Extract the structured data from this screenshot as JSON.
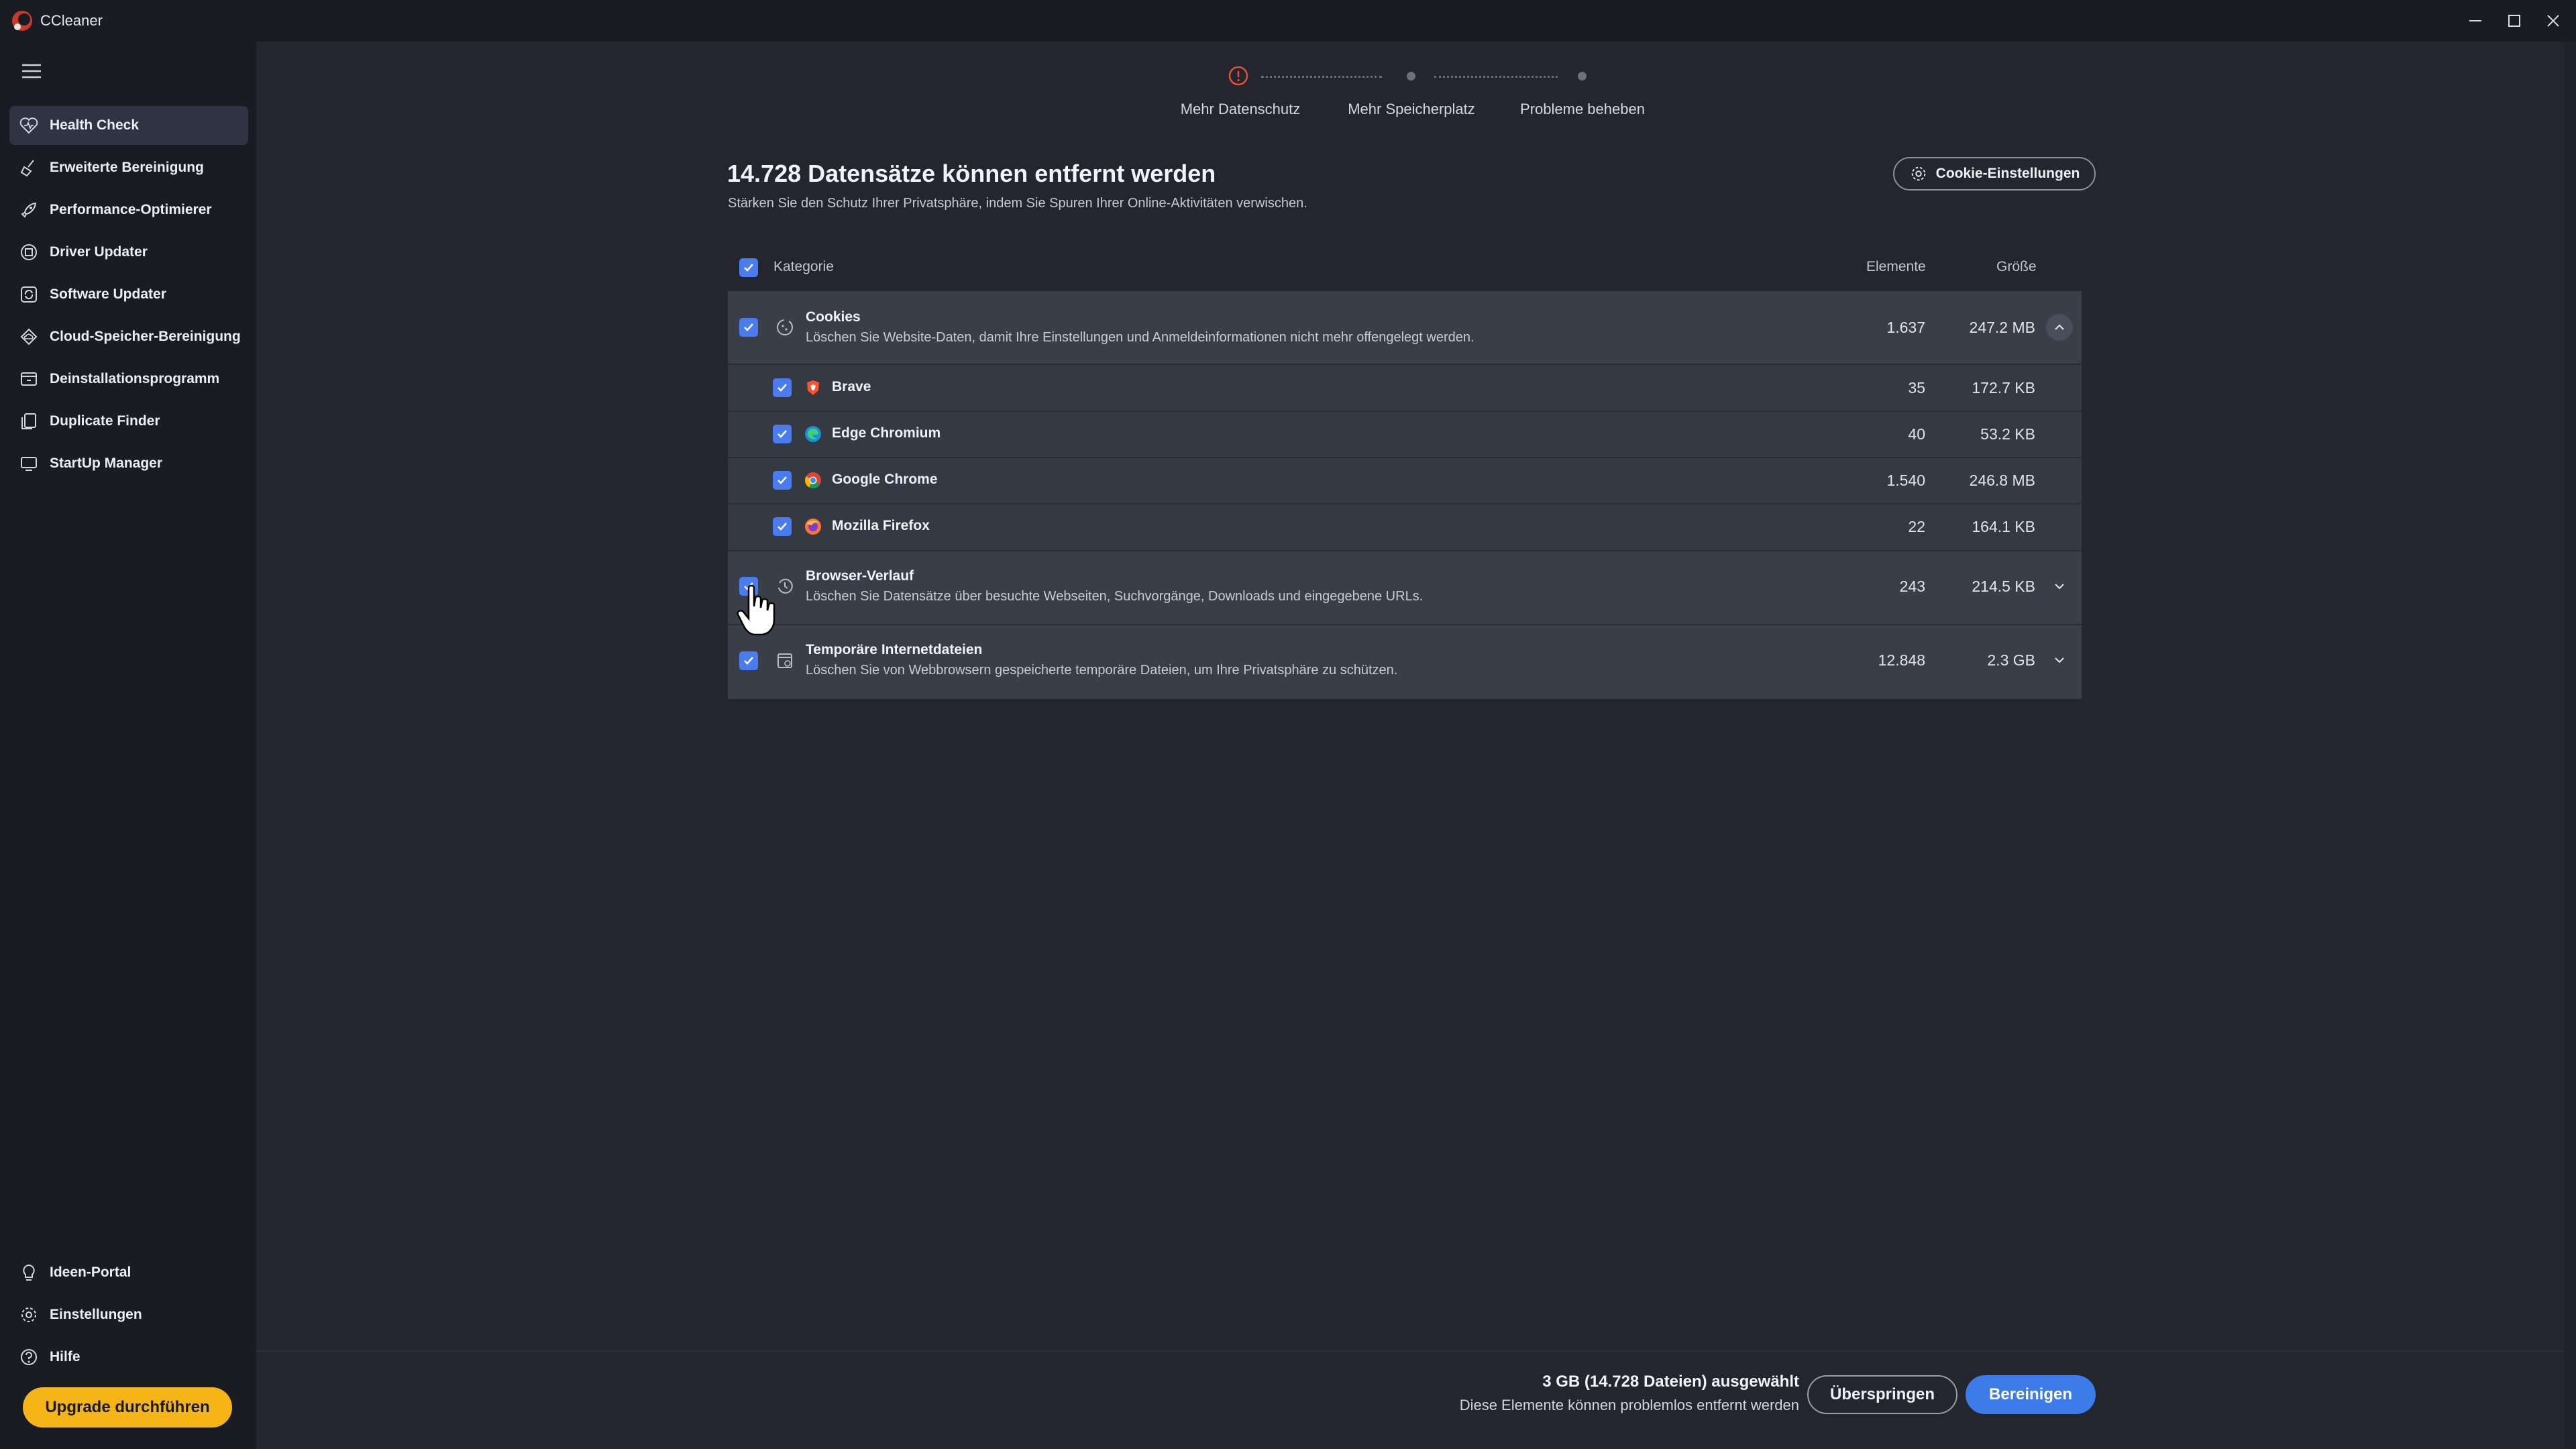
{
  "window": {
    "title": "CCleaner"
  },
  "sidebar": {
    "items": [
      {
        "label": "Health Check",
        "icon": "heart-icon",
        "active": true
      },
      {
        "label": "Erweiterte Bereinigung",
        "icon": "broom-icon"
      },
      {
        "label": "Performance-Optimierer",
        "icon": "rocket-icon"
      },
      {
        "label": "Driver Updater",
        "icon": "driver-icon"
      },
      {
        "label": "Software Updater",
        "icon": "refresh-icon"
      },
      {
        "label": "Cloud-Speicher-Bereinigung",
        "icon": "cloud-icon"
      },
      {
        "label": "Deinstallationsprogramm",
        "icon": "uninstall-icon"
      },
      {
        "label": "Duplicate Finder",
        "icon": "duplicate-icon"
      },
      {
        "label": "StartUp Manager",
        "icon": "monitor-icon"
      }
    ],
    "bottom_items": [
      {
        "label": "Ideen-Portal",
        "icon": "lightbulb-icon"
      },
      {
        "label": "Einstellungen",
        "icon": "gear-icon"
      },
      {
        "label": "Hilfe",
        "icon": "help-icon"
      }
    ],
    "upgrade_label": "Upgrade durchführen"
  },
  "stepper": {
    "steps": [
      {
        "label": "Mehr Datenschutz",
        "state": "current"
      },
      {
        "label": "Mehr Speicherplatz",
        "state": "pending"
      },
      {
        "label": "Probleme beheben",
        "state": "pending"
      }
    ],
    "accent": "#e0533a"
  },
  "main": {
    "title": "14.728 Datensätze können entfernt werden",
    "subtitle": "Stärken Sie den Schutz Ihrer Privatsphäre, indem Sie Spuren Ihrer Online-Aktivitäten verwischen.",
    "cookie_settings_label": "Cookie-Einstellungen"
  },
  "table": {
    "headers": {
      "category": "Kategorie",
      "items": "Elemente",
      "size": "Größe"
    },
    "categories": [
      {
        "title": "Cookies",
        "description": "Löschen Sie Website-Daten, damit Ihre Einstellungen und Anmeldeinformationen nicht mehr offengelegt werden.",
        "items": "1.637",
        "size": "247.2 MB",
        "expanded": true,
        "checked": true,
        "children": [
          {
            "name": "Brave",
            "items": "35",
            "size": "172.7 KB",
            "icon": "brave-icon",
            "checked": true
          },
          {
            "name": "Edge Chromium",
            "items": "40",
            "size": "53.2 KB",
            "icon": "edge-icon",
            "checked": true
          },
          {
            "name": "Google Chrome",
            "items": "1.540",
            "size": "246.8 MB",
            "icon": "chrome-icon",
            "checked": true
          },
          {
            "name": "Mozilla Firefox",
            "items": "22",
            "size": "164.1 KB",
            "icon": "firefox-icon",
            "checked": true
          }
        ]
      },
      {
        "title": "Browser-Verlauf",
        "description": "Löschen Sie Datensätze über besuchte Webseiten, Suchvorgänge, Downloads und eingegebene URLs.",
        "items": "243",
        "size": "214.5 KB",
        "expanded": false,
        "checked": true
      },
      {
        "title": "Temporäre Internetdateien",
        "description": "Löschen Sie von Webbrowsern gespeicherte temporäre Dateien, um Ihre Privatsphäre zu schützen.",
        "items": "12.848",
        "size": "2.3 GB",
        "expanded": false,
        "checked": true
      }
    ]
  },
  "footer": {
    "summary": "3 GB (14.728 Dateien) ausgewählt",
    "note": "Diese Elemente können problemlos entfernt werden",
    "skip_label": "Überspringen",
    "clean_label": "Bereinigen"
  },
  "colors": {
    "primary": "#3c7be8",
    "upgrade": "#f5b517",
    "checkbox": "#4a7cf0"
  }
}
